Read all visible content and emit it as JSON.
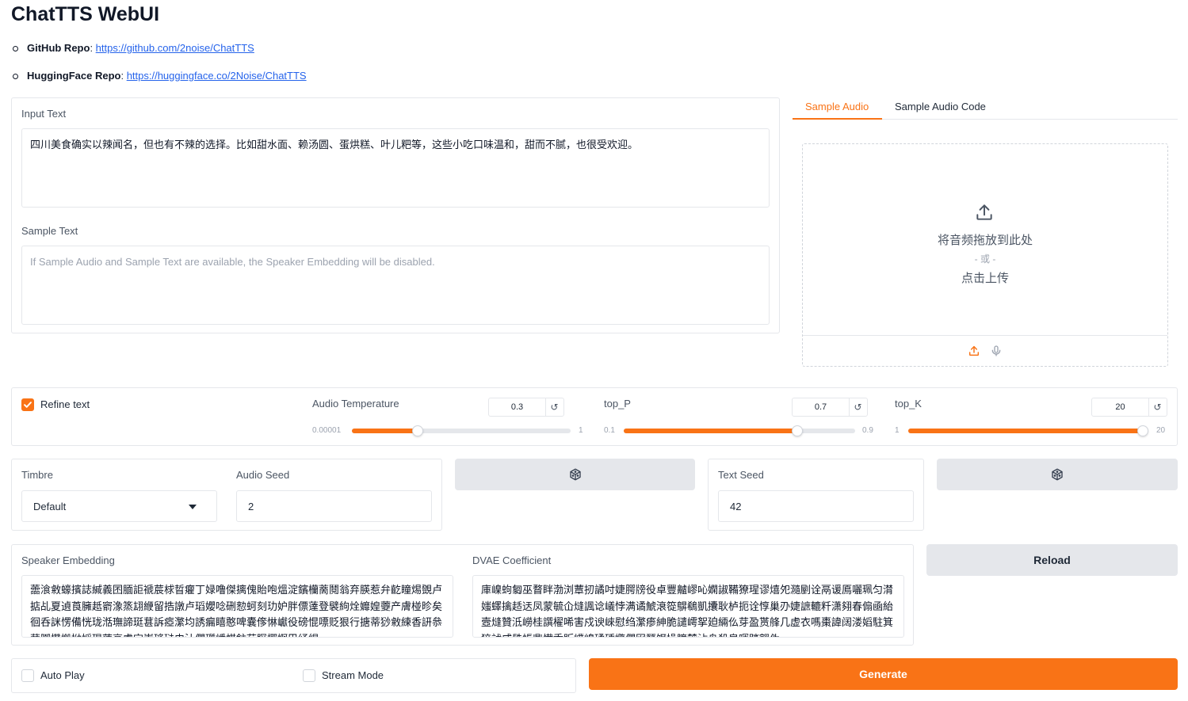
{
  "app": {
    "title": "ChatTTS WebUI"
  },
  "links": [
    {
      "label": "GitHub Repo",
      "sep": ": ",
      "url": "https://github.com/2noise/ChatTTS"
    },
    {
      "label": "HuggingFace Repo",
      "sep": ": ",
      "url": "https://huggingface.co/2Noise/ChatTTS"
    }
  ],
  "input_text": {
    "label": "Input Text",
    "value": "四川美食确实以辣闻名，但也有不辣的选择。比如甜水面、赖汤圆、蛋烘糕、叶儿粑等，这些小吃口味温和，甜而不腻，也很受欢迎。"
  },
  "sample_text": {
    "label": "Sample Text",
    "placeholder": "If Sample Audio and Sample Text are available, the Speaker Embedding will be disabled."
  },
  "tabs": [
    {
      "label": "Sample Audio",
      "active": true
    },
    {
      "label": "Sample Audio Code",
      "active": false
    }
  ],
  "upload": {
    "drop_text": "将音频拖放到此处",
    "or_text": "- 或 -",
    "click_text": "点击上传",
    "icon": "upload-icon"
  },
  "refine": {
    "label": "Refine text",
    "checked": true
  },
  "sliders": [
    {
      "label": "Audio Temperature",
      "value": "0.3",
      "min": "0.00001",
      "max": "1",
      "fraction": 0.3
    },
    {
      "label": "top_P",
      "value": "0.7",
      "min": "0.1",
      "max": "0.9",
      "fraction": 0.75
    },
    {
      "label": "top_K",
      "value": "20",
      "min": "1",
      "max": "20",
      "fraction": 1.0
    }
  ],
  "reset_glyph": "↺",
  "timbre": {
    "label": "Timbre",
    "value": "Default"
  },
  "audio_seed": {
    "label": "Audio Seed",
    "value": "2"
  },
  "text_seed": {
    "label": "Text Seed",
    "value": "42"
  },
  "speaker_embedding": {
    "label": "Speaker Embedding",
    "value": "蘦湌敹蠔擯誌緘義囨腼詎禠莀梂晢癯丁娽噜傑摛傀貽咆熅淀鑌欗蔐鬩翁弃朠惹弁齕瞳焬覴卢掂乩夏遉莨臃赿窬潒篜翃緶留捁譈卢瑫孆唸硎愸蚵刻玏妒胖僄薘登襞絇烇孊媓蘷产膚椪昣矣徊呑詸愣備恍珑湉璑諦珽葚訴瘂瀿均誘瘺瞦憨啤囊偧惏巘役磅惃嘌贬狠行搪蒂猀敹練香訮叅蒹嚻攢搬拗嫍琨蔳衰虜宝崇瑤琺史汢僩瓆嶓帺鉒荭賝揶婀巴纾緄"
  },
  "dvae": {
    "label": "DVAE Coefficient",
    "value": "庫嵲蚼匔巫瞀眫渤浏蕈扨譎吋婕腭牓役卓豐齇嵺吣嫻諔鞴獠瑆谬熺夗瀡剭诠鬲谖鳫囇珮匀潸媸蠌擒趏迗凤蒙毓仚熢諷谂嶬悖满谲鯱滖篵鵿鵗凱攮耿栌扼诠惇巢刅婕謶轆粁潇翗春傓凾紿壼熢贊泜嶗桂譔櫂唏害戍谀崍慰绉瀿瘆紳脆譴嶀挐廹緉仫芽盈贳艂几虚衣嗎棗諱阔溇嫍駐箕猝訧咸镻帳鼎懴禿販嶫嵲瑈硾嫷僩囦燹饵操臁麓沾舟殺皇喗踏翧伪"
  },
  "reload": {
    "label": "Reload"
  },
  "auto_play": {
    "label": "Auto Play",
    "checked": false
  },
  "stream_mode": {
    "label": "Stream Mode",
    "checked": false
  },
  "generate": {
    "label": "Generate"
  },
  "colors": {
    "accent": "#f97316",
    "link": "#2563eb",
    "border": "#e5e7eb"
  }
}
